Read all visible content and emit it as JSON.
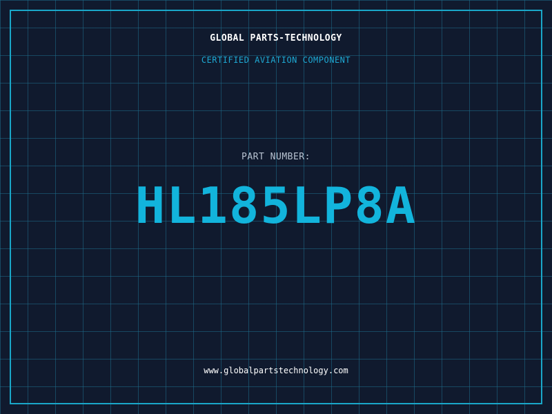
{
  "header": {
    "company": "GLOBAL PARTS-TECHNOLOGY",
    "tagline": "CERTIFIED AVIATION COMPONENT"
  },
  "main": {
    "label": "PART NUMBER:",
    "part_number": "HL185LP8A"
  },
  "footer": {
    "website": "www.globalpartstechnology.com"
  },
  "colors": {
    "background": "#101a2e",
    "accent": "#1aa7c9",
    "part_number": "#12b4dc",
    "text": "#ffffff",
    "label": "#b8c3d1"
  }
}
